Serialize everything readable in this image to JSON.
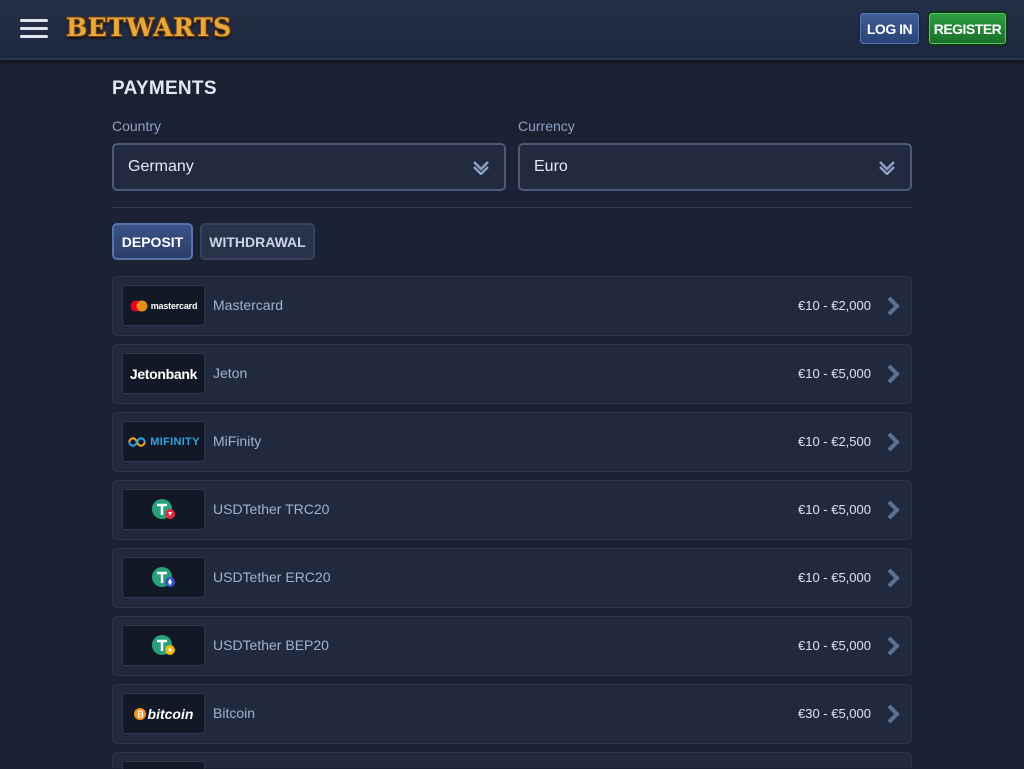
{
  "header": {
    "logo": "BETWARTS",
    "login_label": "LOG IN",
    "register_label": "REGISTER"
  },
  "page": {
    "title": "PAYMENTS",
    "country_label": "Country",
    "country_value": "Germany",
    "currency_label": "Currency",
    "currency_value": "Euro"
  },
  "tabs": {
    "deposit": "DEPOSIT",
    "withdrawal": "WITHDRAWAL"
  },
  "methods": [
    {
      "name": "Mastercard",
      "logo_text": "mastercard",
      "range": "€10 - €2,000"
    },
    {
      "name": "Jeton",
      "logo_text": "Jetonbank",
      "range": "€10 - €5,000"
    },
    {
      "name": "MiFinity",
      "logo_text": "MIFINITY",
      "range": "€10 - €2,500"
    },
    {
      "name": "USDTether TRC20",
      "range": "€10 - €5,000"
    },
    {
      "name": "USDTether ERC20",
      "range": "€10 - €5,000"
    },
    {
      "name": "USDTether BEP20",
      "range": "€10 - €5,000"
    },
    {
      "name": "Bitcoin",
      "logo_text": "bitcoin",
      "range": "€30 - €5,000"
    }
  ],
  "colors": {
    "background": "#1b2233",
    "row_background": "#212a3c",
    "accent_blue": "#3a5287",
    "register_green": "#2f9f43",
    "logo_gold": "#e7a93c",
    "tether_green": "#26a17b"
  }
}
